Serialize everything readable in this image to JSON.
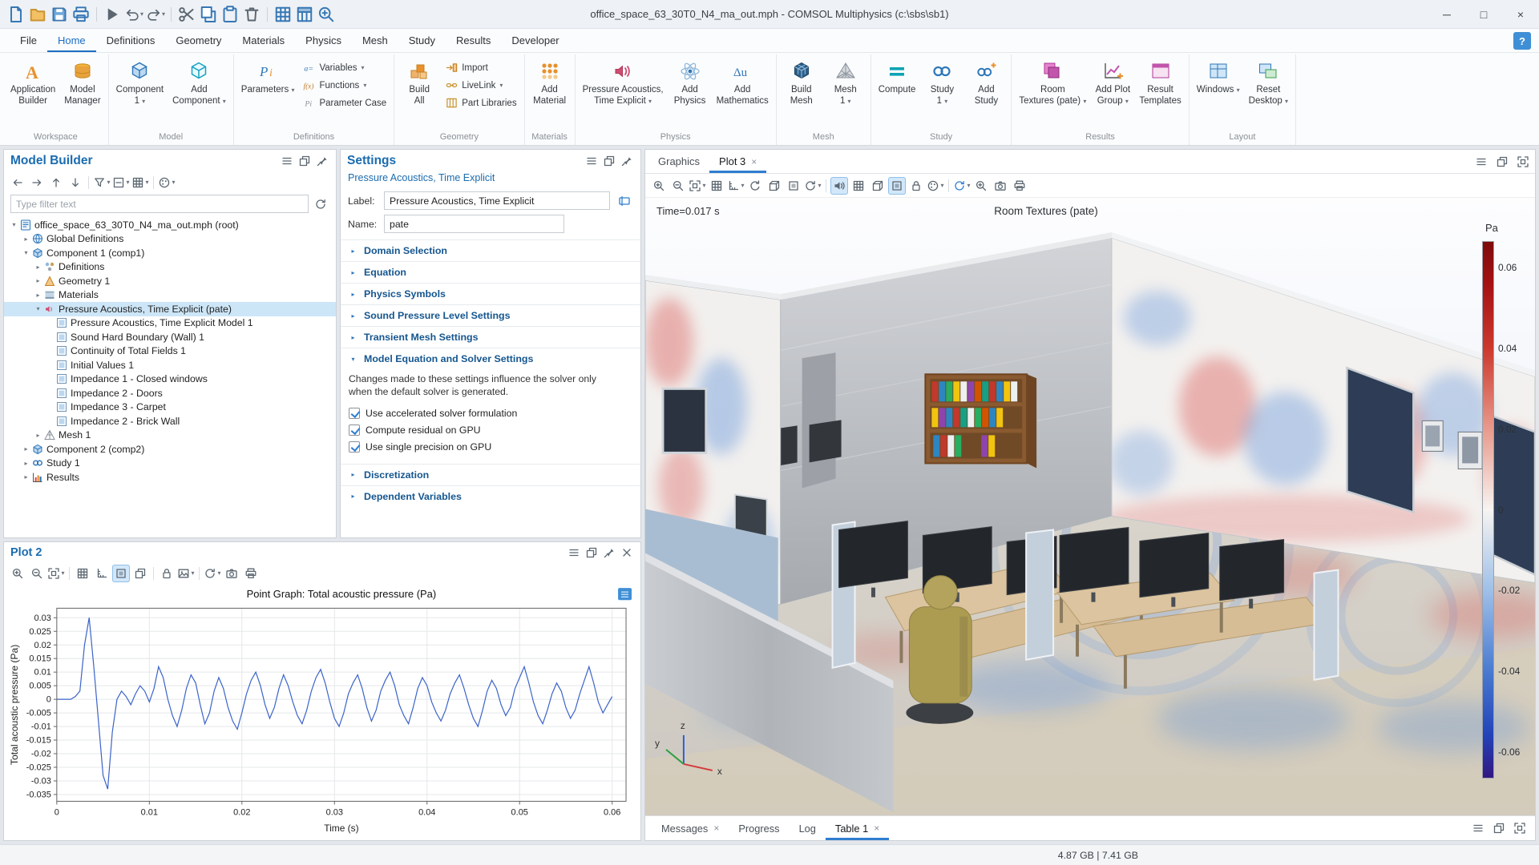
{
  "window": {
    "title": "office_space_63_30T0_N4_ma_out.mph - COMSOL Multiphysics (c:\\sbs\\sb1)"
  },
  "titlebar": {
    "quick_icons": [
      {
        "icon": "doc",
        "cls": "ic-blue",
        "name": "comsol-app"
      },
      {
        "icon": "folder",
        "cls": "ic-orange",
        "name": "open"
      },
      {
        "icon": "save",
        "cls": "ic-blue",
        "name": "save"
      },
      {
        "icon": "printer",
        "cls": "ic-blue",
        "name": "print"
      },
      {
        "sep": true
      },
      {
        "icon": "play",
        "cls": "ic-gray",
        "name": "run"
      },
      {
        "icon": "undo",
        "cls": "ic-gray",
        "name": "undo",
        "caret": true
      },
      {
        "icon": "redo",
        "cls": "ic-gray",
        "name": "redo",
        "caret": true
      },
      {
        "sep": true
      },
      {
        "icon": "scissors",
        "cls": "ic-gray",
        "name": "cut"
      },
      {
        "icon": "copy",
        "cls": "ic-blue",
        "name": "copy"
      },
      {
        "icon": "paste",
        "cls": "ic-blue",
        "name": "paste"
      },
      {
        "icon": "trash",
        "cls": "ic-gray",
        "name": "delete"
      },
      {
        "sep": true
      },
      {
        "icon": "grid",
        "cls": "ic-blue",
        "name": "model-tree"
      },
      {
        "icon": "table",
        "cls": "ic-blue",
        "name": "table-view"
      },
      {
        "icon": "zoom-in",
        "cls": "ic-blue",
        "name": "search"
      }
    ],
    "min": "─",
    "max": "□",
    "close": "×"
  },
  "menubar": {
    "items": [
      {
        "label": "File"
      },
      {
        "label": "Home",
        "active": true
      },
      {
        "label": "Definitions"
      },
      {
        "label": "Geometry"
      },
      {
        "label": "Materials"
      },
      {
        "label": "Physics"
      },
      {
        "label": "Mesh"
      },
      {
        "label": "Study"
      },
      {
        "label": "Results"
      },
      {
        "label": "Developer"
      }
    ],
    "help": "?"
  },
  "ribbon": {
    "groups": [
      {
        "label": "Workspace",
        "items": [
          {
            "type": "big",
            "label": "Application\nBuilder",
            "icon": "app-builder"
          },
          {
            "type": "big",
            "label": "Model\nManager",
            "icon": "model-manager"
          }
        ]
      },
      {
        "label": "Model",
        "items": [
          {
            "type": "big",
            "label": "Component\n1",
            "icon": "component",
            "caret": true
          },
          {
            "type": "big",
            "label": "Add\nComponent",
            "icon": "add-component",
            "caret": true
          }
        ]
      },
      {
        "label": "Definitions",
        "items": [
          {
            "type": "big",
            "label": "Parameters",
            "icon": "parameters",
            "caret": true
          },
          {
            "type": "stack",
            "items": [
              {
                "label": "Variables",
                "icon": "variables-ic",
                "caret": true
              },
              {
                "label": "Functions",
                "icon": "functions-ic",
                "caret": true
              },
              {
                "label": "Parameter Case",
                "icon": "param-case-ic"
              }
            ]
          }
        ]
      },
      {
        "label": "Geometry",
        "items": [
          {
            "type": "big",
            "label": "Build\nAll",
            "icon": "build-all"
          },
          {
            "type": "stack",
            "items": [
              {
                "label": "Import",
                "icon": "import-ic"
              },
              {
                "label": "LiveLink",
                "icon": "livelink-ic",
                "caret": true
              },
              {
                "label": "Part Libraries",
                "icon": "partlib-ic"
              }
            ]
          }
        ]
      },
      {
        "label": "Materials",
        "items": [
          {
            "type": "big",
            "label": "Add\nMaterial",
            "icon": "add-material"
          }
        ]
      },
      {
        "label": "Physics",
        "items": [
          {
            "type": "big",
            "label": "Pressure Acoustics,\nTime Explicit",
            "icon": "acoustics",
            "caret": true
          },
          {
            "type": "big",
            "label": "Add\nPhysics",
            "icon": "add-physics"
          },
          {
            "type": "big",
            "label": "Add\nMathematics",
            "icon": "add-math"
          }
        ]
      },
      {
        "label": "Mesh",
        "items": [
          {
            "type": "big",
            "label": "Build\nMesh",
            "icon": "build-mesh"
          },
          {
            "type": "big",
            "label": "Mesh\n1",
            "icon": "mesh1",
            "caret": true
          }
        ]
      },
      {
        "label": "Study",
        "items": [
          {
            "type": "big",
            "label": "Compute",
            "icon": "compute"
          },
          {
            "type": "big",
            "label": "Study\n1",
            "icon": "study1",
            "caret": true
          },
          {
            "type": "big",
            "label": "Add\nStudy",
            "icon": "add-study"
          }
        ]
      },
      {
        "label": "Results",
        "items": [
          {
            "type": "big",
            "label": "Room\nTextures (pate)",
            "icon": "room-textures",
            "caret": true
          },
          {
            "type": "big",
            "label": "Add Plot\nGroup",
            "icon": "add-plot",
            "caret": true
          },
          {
            "type": "big",
            "label": "Result\nTemplates",
            "icon": "result-templates"
          }
        ]
      },
      {
        "label": "Layout",
        "items": [
          {
            "type": "big",
            "label": "Windows",
            "icon": "windows-ic",
            "caret": true
          },
          {
            "type": "big",
            "label": "Reset\nDesktop",
            "icon": "reset-desktop",
            "caret": true
          }
        ]
      }
    ]
  },
  "model_builder": {
    "title": "Model Builder",
    "filter_placeholder": "Type filter text",
    "toolbar": [
      {
        "icon": "aleft",
        "name": "back"
      },
      {
        "icon": "aright",
        "name": "forward"
      },
      {
        "icon": "aup",
        "name": "move-up"
      },
      {
        "icon": "adown",
        "name": "move-down"
      },
      {
        "sep": true
      },
      {
        "icon": "funnel",
        "name": "show-filter",
        "caret": true
      },
      {
        "icon": "collapse",
        "name": "collapse-all",
        "caret": true
      },
      {
        "icon": "grid",
        "name": "model-tree-columns",
        "caret": true
      },
      {
        "sep": true
      },
      {
        "icon": "palette",
        "name": "node-colors",
        "caret": true
      }
    ],
    "tree": [
      {
        "label": "office_space_63_30T0_N4_ma_out.mph (root)",
        "icon": "root",
        "level": 0,
        "chev": "expanded"
      },
      {
        "label": "Global Definitions",
        "icon": "globe",
        "level": 1,
        "chev": "collapsed"
      },
      {
        "label": "Component 1 (comp1)",
        "icon": "component",
        "level": 1,
        "chev": "expanded"
      },
      {
        "label": "Definitions",
        "icon": "definitions",
        "level": 2,
        "chev": "collapsed"
      },
      {
        "label": "Geometry 1",
        "icon": "geometry",
        "level": 2,
        "chev": "collapsed"
      },
      {
        "label": "Materials",
        "icon": "materials",
        "level": 2,
        "chev": "collapsed"
      },
      {
        "label": "Pressure Acoustics, Time Explicit (pate)",
        "icon": "acoustics-sm",
        "level": 2,
        "chev": "expanded",
        "selected": true
      },
      {
        "label": "Pressure Acoustics, Time Explicit Model 1",
        "icon": "node",
        "level": 3,
        "chev": "none"
      },
      {
        "label": "Sound Hard Boundary (Wall) 1",
        "icon": "node",
        "level": 3,
        "chev": "none"
      },
      {
        "label": "Continuity of Total Fields 1",
        "icon": "node",
        "level": 3,
        "chev": "none"
      },
      {
        "label": "Initial Values 1",
        "icon": "node",
        "level": 3,
        "chev": "none"
      },
      {
        "label": "Impedance 1 - Closed windows",
        "icon": "node",
        "level": 3,
        "chev": "none"
      },
      {
        "label": "Impedance 2 - Doors",
        "icon": "node",
        "level": 3,
        "chev": "none"
      },
      {
        "label": "Impedance 3 - Carpet",
        "icon": "node",
        "level": 3,
        "chev": "none"
      },
      {
        "label": "Impedance 2 - Brick Wall",
        "icon": "node",
        "level": 3,
        "chev": "none"
      },
      {
        "label": "Mesh 1",
        "icon": "mesh",
        "level": 2,
        "chev": "collapsed"
      },
      {
        "label": "Component 2 (comp2)",
        "icon": "component",
        "level": 1,
        "chev": "collapsed"
      },
      {
        "label": "Study 1",
        "icon": "study",
        "level": 1,
        "chev": "collapsed"
      },
      {
        "label": "Results",
        "icon": "results",
        "level": 1,
        "chev": "collapsed"
      }
    ]
  },
  "settings": {
    "title": "Settings",
    "subtitle": "Pressure Acoustics, Time Explicit",
    "label_label": "Label:",
    "label_value": "Pressure Acoustics, Time Explicit",
    "name_label": "Name:",
    "name_value": "pate",
    "sections": [
      {
        "label": "Domain Selection"
      },
      {
        "label": "Equation"
      },
      {
        "label": "Physics Symbols"
      },
      {
        "label": "Sound Pressure Level Settings"
      },
      {
        "label": "Transient Mesh Settings"
      },
      {
        "label": "Model Equation and Solver Settings",
        "expanded": true,
        "note": "Changes made to these settings influence the solver only when the default solver is generated.",
        "checkboxes": [
          {
            "label": "Use accelerated solver formulation",
            "checked": true
          },
          {
            "label": "Compute residual on GPU",
            "checked": true
          },
          {
            "label": "Use single precision on GPU",
            "checked": true
          }
        ]
      },
      {
        "label": "Discretization"
      },
      {
        "label": "Dependent Variables"
      }
    ]
  },
  "plot2": {
    "title": "Plot 2",
    "toolbar": [
      {
        "icon": "zoom-in",
        "name": "zoom-in"
      },
      {
        "icon": "zoom-out",
        "name": "zoom-out"
      },
      {
        "icon": "extents",
        "name": "zoom-extents",
        "caret": true
      },
      {
        "sep": true
      },
      {
        "icon": "grid",
        "name": "grid-lines"
      },
      {
        "icon": "axis",
        "name": "axis-settings"
      },
      {
        "icon": "ortho",
        "name": "plot-window-split",
        "active": true
      },
      {
        "icon": "float",
        "name": "plot-dock"
      },
      {
        "sep": true
      },
      {
        "icon": "lock",
        "name": "lock-axes"
      },
      {
        "icon": "image",
        "name": "image-export",
        "caret": true
      },
      {
        "sep": true
      },
      {
        "icon": "refresh",
        "name": "plot-update",
        "caret": true
      },
      {
        "icon": "camera",
        "name": "image-snapshot"
      },
      {
        "icon": "printer",
        "name": "print-plot"
      }
    ],
    "chart_data": {
      "type": "line",
      "title": "Point Graph: Total acoustic pressure (Pa)",
      "xlabel": "Time (s)",
      "ylabel": "Total acoustic pressure (Pa)",
      "xlim": [
        0,
        0.0615
      ],
      "ylim": [
        -0.0375,
        0.0335
      ],
      "xticks": [
        0,
        0.01,
        0.02,
        0.03,
        0.04,
        0.05,
        0.06
      ],
      "yticks": [
        0.03,
        0.025,
        0.02,
        0.015,
        0.01,
        0.005,
        0,
        -0.005,
        -0.01,
        -0.015,
        -0.02,
        -0.025,
        -0.03,
        -0.035
      ],
      "grid": true,
      "line_color": "#3b63c8",
      "series": [
        {
          "name": "Total acoustic pressure",
          "x_start": 0,
          "x_step": 0.0005,
          "y": [
            0,
            0,
            0,
            0,
            0.001,
            0.003,
            0.02,
            0.03,
            0.012,
            -0.008,
            -0.028,
            -0.033,
            -0.012,
            0,
            0.003,
            0.001,
            -0.002,
            0.002,
            0.005,
            0.003,
            -0.001,
            0.004,
            0.012,
            0.008,
            0,
            -0.006,
            -0.01,
            -0.004,
            0.004,
            0.009,
            0.006,
            -0.002,
            -0.009,
            -0.005,
            0.003,
            0.008,
            0.004,
            -0.003,
            -0.008,
            -0.011,
            -0.005,
            0.002,
            0.007,
            0.01,
            0.005,
            -0.002,
            -0.007,
            -0.003,
            0.004,
            0.009,
            0.005,
            -0.001,
            -0.006,
            -0.009,
            -0.004,
            0.003,
            0.008,
            0.011,
            0.006,
            -0.001,
            -0.007,
            -0.01,
            -0.005,
            0.002,
            0.006,
            0.009,
            0.004,
            -0.003,
            -0.008,
            -0.004,
            0.003,
            0.007,
            0.01,
            0.005,
            -0.002,
            -0.006,
            -0.009,
            -0.003,
            0.004,
            0.008,
            0.005,
            -0.001,
            -0.005,
            -0.008,
            -0.004,
            0.002,
            0.006,
            0.009,
            0.004,
            -0.002,
            -0.007,
            -0.01,
            -0.004,
            0.003,
            0.007,
            0.004,
            -0.002,
            -0.006,
            -0.003,
            0.004,
            0.008,
            0.012,
            0.006,
            -0.001,
            -0.006,
            -0.009,
            -0.004,
            0.002,
            0.006,
            0.003,
            -0.003,
            -0.007,
            -0.004,
            0.002,
            0.007,
            0.012,
            0.006,
            -0.001,
            -0.005,
            -0.002,
            0.001
          ]
        }
      ]
    }
  },
  "graphics": {
    "tabs": [
      {
        "label": "Graphics"
      },
      {
        "label": "Plot 3",
        "close": true,
        "active": true
      }
    ],
    "toolbar": [
      {
        "icon": "zoom-in",
        "name": "zoom-in"
      },
      {
        "icon": "zoom-out",
        "name": "zoom-out"
      },
      {
        "icon": "extents",
        "name": "zoom-extents",
        "caret": true
      },
      {
        "icon": "grid",
        "name": "go-to-grid"
      },
      {
        "icon": "axis",
        "name": "go-to-default-view",
        "caret": true
      },
      {
        "icon": "rotate",
        "name": "view-rotate"
      },
      {
        "icon": "persp",
        "name": "view-xy"
      },
      {
        "icon": "ortho",
        "name": "view-yz"
      },
      {
        "icon": "refresh",
        "name": "scene-rebuild",
        "caret": true
      },
      {
        "sep": true
      },
      {
        "icon": "speaker",
        "name": "play-sound",
        "active": true
      },
      {
        "icon": "grid",
        "name": "show-grid"
      },
      {
        "icon": "persp",
        "name": "perspective-view"
      },
      {
        "icon": "ortho",
        "name": "orthographic-view",
        "active": true
      },
      {
        "icon": "lock",
        "name": "lock-camera"
      },
      {
        "icon": "palette",
        "name": "color-theme",
        "caret": true
      },
      {
        "sep": true
      },
      {
        "icon": "refresh",
        "name": "plot-update",
        "cls": "ic-bright",
        "caret": true
      },
      {
        "icon": "zoom-in",
        "name": "zoom-box"
      },
      {
        "icon": "camera",
        "name": "image-snapshot"
      },
      {
        "icon": "printer",
        "name": "print-graphics"
      }
    ],
    "time_label": "Time=0.017 s",
    "plot_title": "Room Textures (pate)",
    "colorbar": {
      "unit": "Pa",
      "max": 0.0665,
      "min": -0.0665,
      "ticks": [
        0.06,
        0.04,
        0.02,
        0,
        -0.02,
        -0.04,
        -0.06
      ]
    }
  },
  "bottom_tabs": [
    {
      "label": "Messages",
      "close": true
    },
    {
      "label": "Progress"
    },
    {
      "label": "Log"
    },
    {
      "label": "Table 1",
      "close": true,
      "active": true
    }
  ],
  "status_bar": {
    "memory": "4.87 GB | 7.41 GB"
  }
}
